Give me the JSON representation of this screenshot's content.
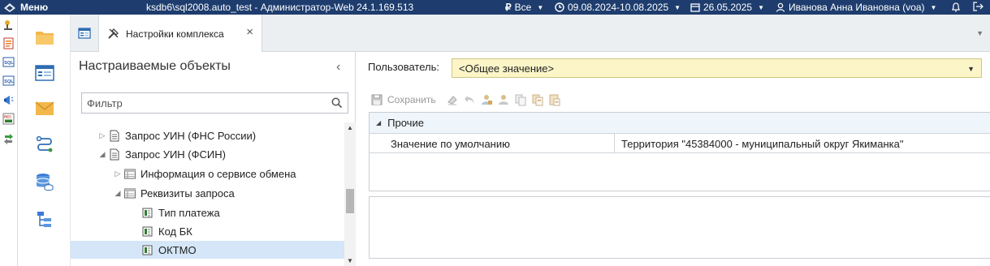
{
  "topbar": {
    "menu_label": "Меню",
    "window_title": "ksdb6\\sql2008.auto_test - Администратор-Web 24.1.169.513",
    "currency_label": "Все",
    "period_label": "09.08.2024-10.08.2025",
    "date_label": "26.05.2025",
    "user_label": "Иванова Анна Ивановна (voa)"
  },
  "tabs": {
    "active_label": "Настройки комплекса",
    "close_glyph": "×"
  },
  "tree": {
    "title": "Настраиваемые объекты",
    "collapse_glyph": "‹",
    "filter_placeholder": "Фильтр",
    "items": [
      {
        "label": "Запрос УИН (ФНС России)",
        "expander": "▷",
        "icon": "document-icon"
      },
      {
        "label": "Запрос УИН (ФСИН)",
        "expander": "◢",
        "icon": "document-icon"
      },
      {
        "label": "Информация о сервисе обмена",
        "expander": "▷",
        "icon": "table-icon"
      },
      {
        "label": "Реквизиты запроса",
        "expander": "◢",
        "icon": "table-icon"
      },
      {
        "label": "Тип платежа",
        "expander": "",
        "icon": "field-icon"
      },
      {
        "label": "Код БК",
        "expander": "",
        "icon": "field-icon"
      },
      {
        "label": "ОКТМО",
        "expander": "",
        "icon": "field-icon",
        "selected": true
      }
    ]
  },
  "settings": {
    "user_label": "Пользователь:",
    "user_value": "<Общее значение>",
    "save_label": "Сохранить",
    "group_label": "Прочие",
    "row_name": "Значение по умолчанию",
    "row_value": "Территория \"45384000 - муниципальный округ Якиманка\""
  },
  "colors": {
    "topbar_bg": "#1e3d6e",
    "selection_bg": "#d4e6f7",
    "select_bg": "#fbf5c8",
    "group_bg": "#eef5fb"
  }
}
